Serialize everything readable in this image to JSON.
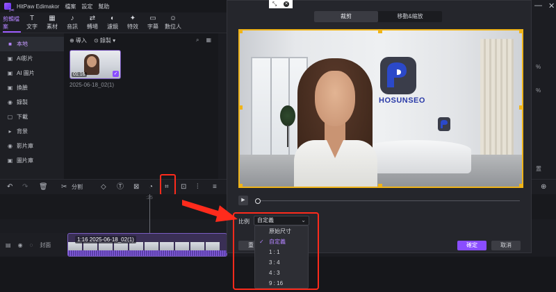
{
  "app": {
    "title": "HitPaw Edimakor",
    "menu": [
      "檔案",
      "設定",
      "幫助"
    ]
  },
  "toolbar": [
    {
      "icon": "scissors-icon",
      "glyph": "✂",
      "label": "剪輯檔案",
      "active": true
    },
    {
      "icon": "text-icon",
      "glyph": "T",
      "label": "文字",
      "active": false
    },
    {
      "icon": "sticker-icon",
      "glyph": "▦",
      "label": "素材",
      "active": false
    },
    {
      "icon": "audio-icon",
      "glyph": "♪",
      "label": "音訊",
      "active": false
    },
    {
      "icon": "transition-icon",
      "glyph": "⇄",
      "label": "轉場",
      "active": false
    },
    {
      "icon": "filter-icon",
      "glyph": "◐",
      "label": "濾鏡",
      "active": false
    },
    {
      "icon": "effect-icon",
      "glyph": "✦",
      "label": "特效",
      "active": false
    },
    {
      "icon": "subtitle-icon",
      "glyph": "▭",
      "label": "字幕",
      "active": false
    },
    {
      "icon": "avatar-icon",
      "glyph": "☺",
      "label": "數位人",
      "active": false
    }
  ],
  "sidebar": [
    {
      "icon": "folder-icon",
      "glyph": "■",
      "label": "本地",
      "active": true
    },
    {
      "icon": "ai-video-icon",
      "glyph": "▣",
      "label": "AI影片",
      "active": false
    },
    {
      "icon": "ai-image-icon",
      "glyph": "▣",
      "label": "AI 圖片",
      "active": false
    },
    {
      "icon": "swap-icon",
      "glyph": "▣",
      "label": "換臉",
      "active": false
    },
    {
      "icon": "record-icon",
      "glyph": "◉",
      "label": "錄製",
      "active": false
    },
    {
      "icon": "download-icon",
      "glyph": "▢",
      "label": "下載",
      "active": false
    },
    {
      "icon": "background-icon",
      "glyph": "▸",
      "label": "背景",
      "active": false
    },
    {
      "icon": "video-library-icon",
      "glyph": "◉",
      "label": "影片庫",
      "active": false
    },
    {
      "icon": "image-library-icon",
      "glyph": "▣",
      "label": "圖片庫",
      "active": false
    }
  ],
  "media": {
    "import_label": "⊕ 導入",
    "record_label": "⊙ 錄製 ▾",
    "clip_duration": "01:16",
    "clip_name": "2025-06-18_02(1)"
  },
  "timeline": {
    "split_label": "分割",
    "track_label": "封面",
    "clip_label": "1:16  2025-06-18_02(1)",
    "ruler_label": ":25"
  },
  "right_panel": {
    "pct1": "%",
    "pct2": "%",
    "setting": "置"
  },
  "dialog": {
    "tabs": [
      {
        "label": "裁剪",
        "active": true
      },
      {
        "label": "移動&縮放",
        "active": false
      }
    ],
    "brand_text": "HOSUNSEO",
    "ratio_label": "比例",
    "ratio_value": "自定義",
    "reset_label": "重",
    "ok_label": "確定",
    "cancel_label": "取消",
    "dropdown_options": [
      {
        "label": "原始尺寸",
        "selected": false
      },
      {
        "label": "自定義",
        "selected": true
      },
      {
        "label": "1 : 1",
        "selected": false
      },
      {
        "label": "3 : 4",
        "selected": false
      },
      {
        "label": "4 : 3",
        "selected": false
      },
      {
        "label": "9 : 16",
        "selected": false
      }
    ]
  },
  "colors": {
    "accent": "#8a4dff",
    "crop_frame": "#f0b419",
    "annotation": "#ff2b1c"
  }
}
